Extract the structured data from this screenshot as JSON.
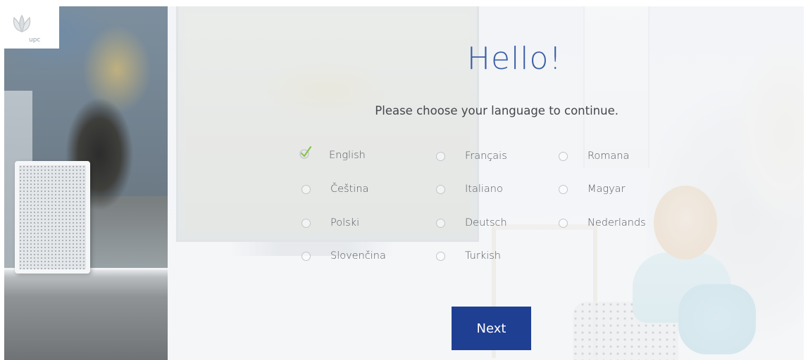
{
  "brand": {
    "logo_text": "upc"
  },
  "page": {
    "title": "Hello!",
    "subtitle": "Please choose your language to continue."
  },
  "languages": [
    {
      "label": "English",
      "selected": true
    },
    {
      "label": "Français",
      "selected": false
    },
    {
      "label": "Romana",
      "selected": false
    },
    {
      "label": "Čeština",
      "selected": false
    },
    {
      "label": "Italiano",
      "selected": false
    },
    {
      "label": "Magyar",
      "selected": false
    },
    {
      "label": "Polski",
      "selected": false
    },
    {
      "label": "Deutsch",
      "selected": false
    },
    {
      "label": "Nederlands",
      "selected": false
    },
    {
      "label": "Slovenčina",
      "selected": false
    },
    {
      "label": "Turkish",
      "selected": false
    }
  ],
  "actions": {
    "next_label": "Next"
  },
  "colors": {
    "accent": "#1f3f93",
    "title": "#3b5fa6",
    "check": "#8bc34a"
  },
  "icons": {
    "logo": "upc-logo-icon",
    "selected_marker": "checkmark-icon",
    "unselected_marker": "radio-circle-icon"
  }
}
